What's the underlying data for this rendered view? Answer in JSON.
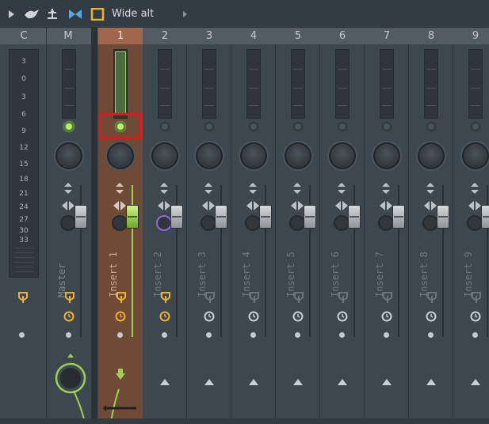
{
  "toolbar": {
    "title": "Wide alt",
    "icons": [
      "play-arrow-icon",
      "bird-icon",
      "balance-icon",
      "bowtie-icon",
      "square-icon",
      "more-arrow-icon"
    ]
  },
  "header": {
    "columns": [
      "C",
      "M",
      "1",
      "2",
      "3",
      "4",
      "5",
      "6",
      "7",
      "8",
      "9"
    ],
    "selected": "1"
  },
  "c_meter": {
    "ticks": [
      "3",
      "0",
      "3",
      "6",
      "9",
      "12",
      "15",
      "18",
      "21",
      "24",
      "27",
      "30",
      "33"
    ]
  },
  "strips": [
    {
      "name": "Master"
    },
    {
      "name": "Insert 1"
    },
    {
      "name": "Insert 2"
    },
    {
      "name": "Insert 3"
    },
    {
      "name": "Insert 4"
    },
    {
      "name": "Insert 5"
    },
    {
      "name": "Insert 6"
    },
    {
      "name": "Insert 7"
    },
    {
      "name": "Insert 8"
    },
    {
      "name": "Insert 9"
    }
  ],
  "colors": {
    "selected_strip": "#6e4a37",
    "selected_header": "#a0674a",
    "accent_green": "#9fd050",
    "highlight_box": "#e0181c",
    "route_orange": "#f0b030",
    "purple_ring": "#8f6ad8"
  }
}
